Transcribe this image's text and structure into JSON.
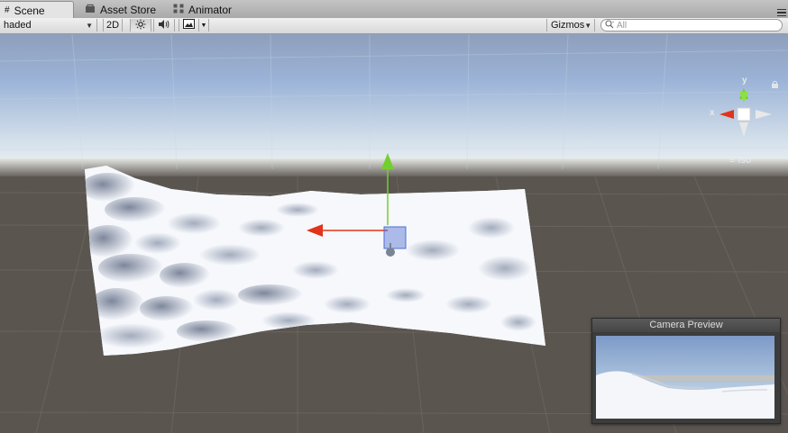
{
  "tabs": [
    {
      "label": "Scene",
      "icon": "scene-icon",
      "active": true
    },
    {
      "label": "Asset Store",
      "icon": "asset-store-icon",
      "active": false
    },
    {
      "label": "Animator",
      "icon": "animator-icon",
      "active": false
    }
  ],
  "toolbar": {
    "render_mode": "haded",
    "mode_2d": "2D",
    "gizmos_label": "Gizmos",
    "search_placeholder": "All"
  },
  "gizmo": {
    "x_label": "x",
    "y_label": "y",
    "projection_label": "Iso"
  },
  "camera_preview": {
    "title": "Camera Preview"
  },
  "colors": {
    "sky_top": "#8a9fc0",
    "sky_horizon": "#e4ecf4",
    "ground": "#5b5550",
    "x_axis": "#e0341c",
    "y_axis": "#73cf2e",
    "selection": "#4f6fd0"
  }
}
